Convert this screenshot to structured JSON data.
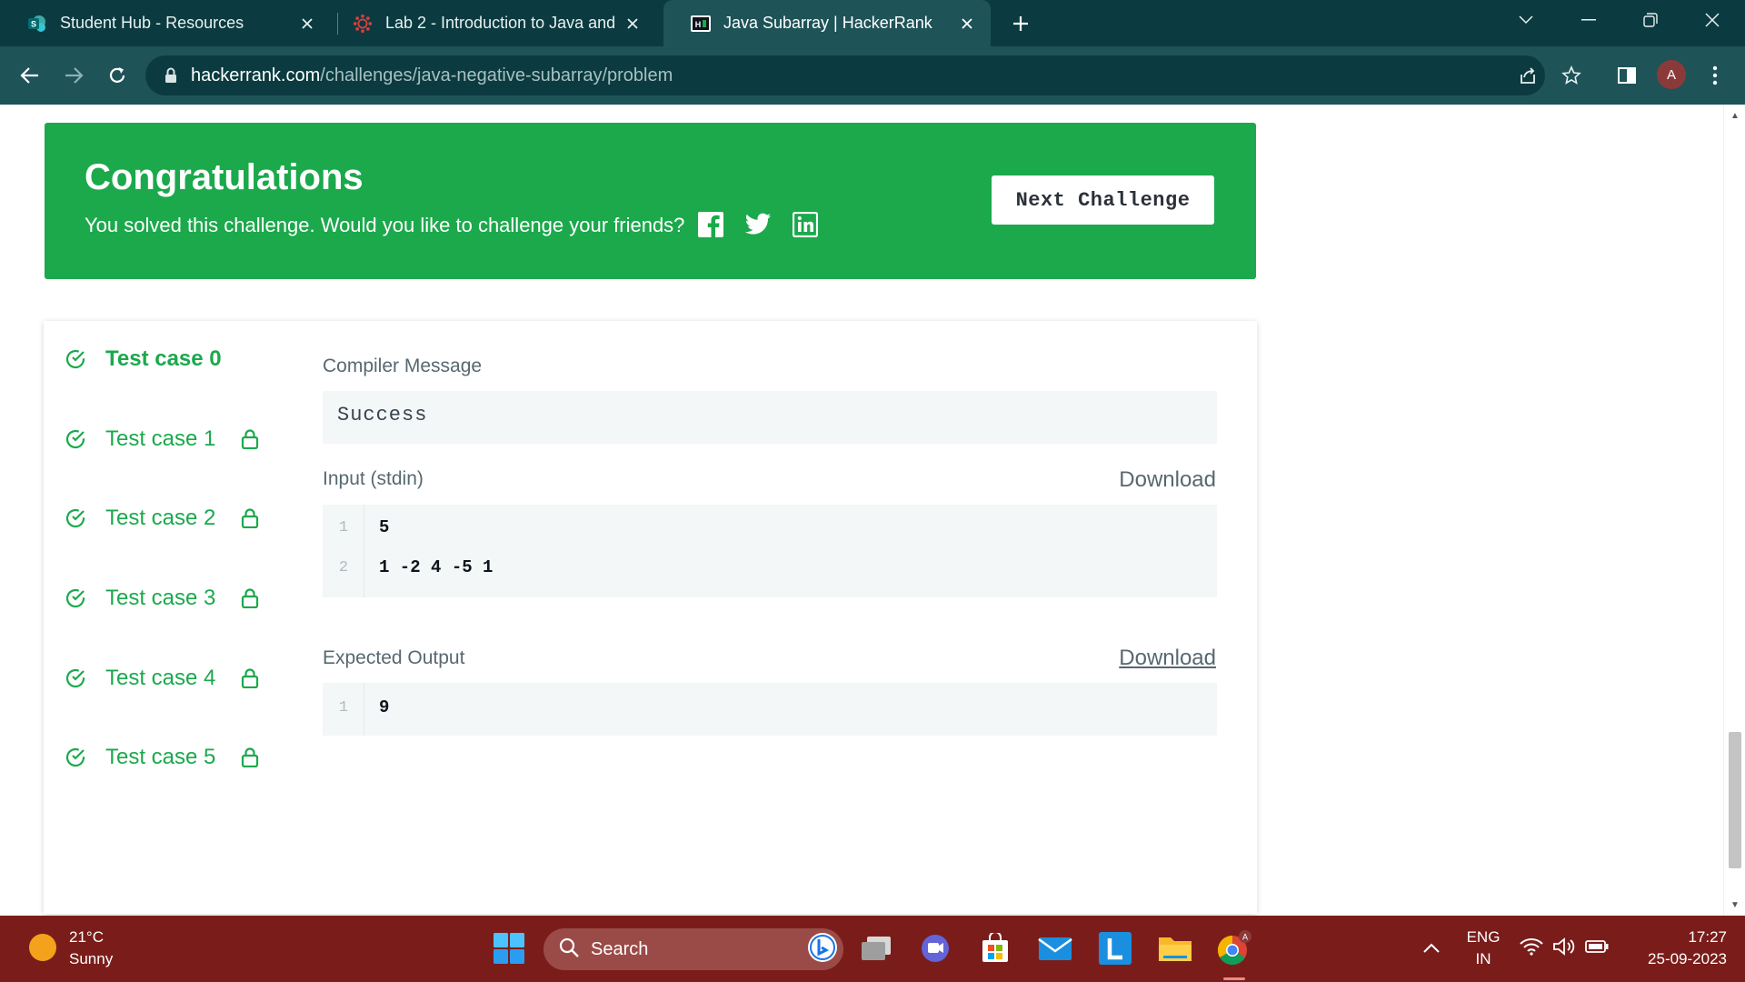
{
  "browser": {
    "tabs": [
      {
        "title": "Student Hub - Resources",
        "active": false,
        "favicon": "sharepoint-icon"
      },
      {
        "title": "Lab 2 - Introduction to Java and",
        "active": false,
        "favicon": "canvas-icon"
      },
      {
        "title": "Java Subarray | HackerRank",
        "active": true,
        "favicon": "hackerrank-icon"
      }
    ],
    "url_host": "hackerrank.com",
    "url_path": "/challenges/java-negative-subarray/problem",
    "profile_initial": "A"
  },
  "banner": {
    "title": "Congratulations",
    "message": "You solved this challenge. Would you like to challenge your friends?",
    "next_button": "Next Challenge",
    "social": [
      "facebook-icon",
      "twitter-icon",
      "linkedin-icon"
    ]
  },
  "test_cases": [
    {
      "label": "Test case 0",
      "passed": true,
      "locked": false,
      "active": true
    },
    {
      "label": "Test case 1",
      "passed": true,
      "locked": true,
      "active": false
    },
    {
      "label": "Test case 2",
      "passed": true,
      "locked": true,
      "active": false
    },
    {
      "label": "Test case 3",
      "passed": true,
      "locked": true,
      "active": false
    },
    {
      "label": "Test case 4",
      "passed": true,
      "locked": true,
      "active": false
    },
    {
      "label": "Test case 5",
      "passed": true,
      "locked": true,
      "active": false
    }
  ],
  "compiler": {
    "label": "Compiler Message",
    "message": "Success"
  },
  "input": {
    "label": "Input (stdin)",
    "download": "Download",
    "lines": [
      {
        "num": "1",
        "text": "5"
      },
      {
        "num": "2",
        "text": "1 -2 4 -5 1"
      }
    ]
  },
  "expected": {
    "label": "Expected Output",
    "download": "Download",
    "lines": [
      {
        "num": "1",
        "text": "9"
      }
    ]
  },
  "taskbar": {
    "temperature": "21°C",
    "weather": "Sunny",
    "search_placeholder": "Search",
    "lang_top": "ENG",
    "lang_bottom": "IN",
    "time": "17:27",
    "date": "25-09-2023"
  },
  "colors": {
    "accent": "#1ba94c",
    "chrome": "#1e5358",
    "taskbar": "#7a1d1a"
  }
}
